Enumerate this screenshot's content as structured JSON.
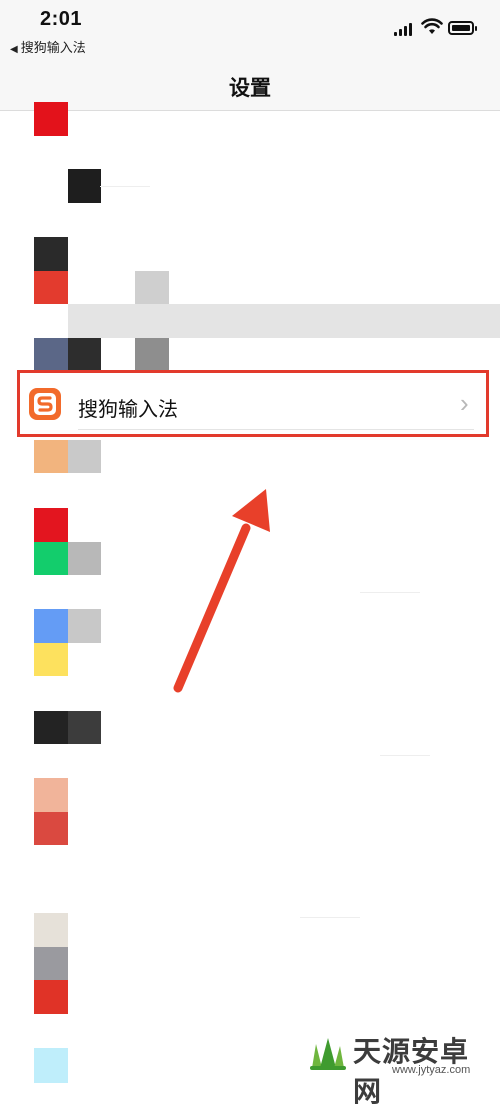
{
  "status_bar": {
    "time": "2:01",
    "back_app_label": "搜狗输入法",
    "back_arrow_glyph": "◀"
  },
  "nav": {
    "title": "设置"
  },
  "highlighted_row": {
    "label": "搜狗输入法",
    "chevron": "›",
    "icon": "sogou-s-icon",
    "highlight_color": "#e23a2c"
  },
  "watermark": {
    "text": "天源安卓网",
    "url": "www.jytyaz.com"
  },
  "colors": {
    "icon_orange": "#f26a2b",
    "annotation_red": "#e8402a"
  }
}
